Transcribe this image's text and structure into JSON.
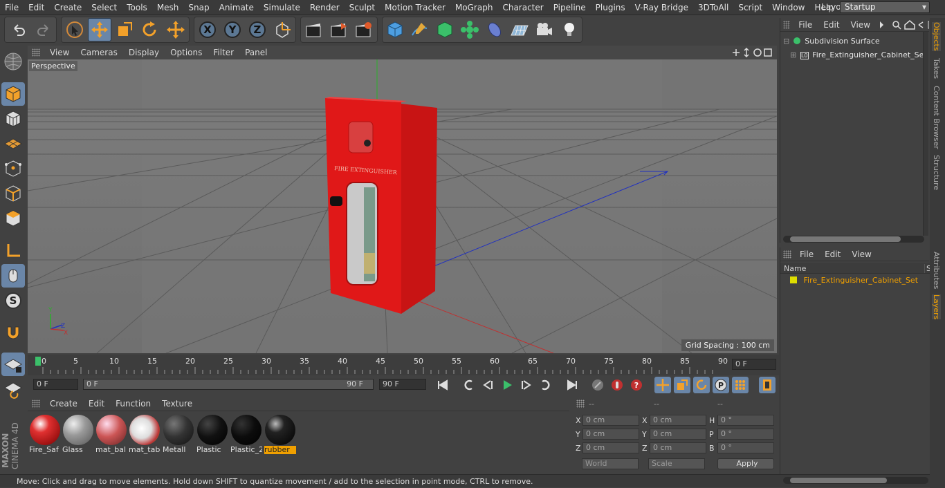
{
  "menu": [
    "File",
    "Edit",
    "Create",
    "Select",
    "Tools",
    "Mesh",
    "Snap",
    "Animate",
    "Simulate",
    "Render",
    "Sculpt",
    "Motion Tracker",
    "MoGraph",
    "Character",
    "Pipeline",
    "Plugins",
    "V-Ray Bridge",
    "3DToAll",
    "Script",
    "Window",
    "Help"
  ],
  "layout": {
    "label": "Layout:",
    "value": "Startup"
  },
  "viewport": {
    "menu": [
      "View",
      "Cameras",
      "Display",
      "Options",
      "Filter",
      "Panel"
    ],
    "camera_label": "Perspective",
    "grid_spacing": "Grid Spacing : 100 cm",
    "object_text": "FIRE EXTINGUISHER"
  },
  "timeline": {
    "ticks": [
      "0",
      "5",
      "10",
      "15",
      "20",
      "25",
      "30",
      "35",
      "40",
      "45",
      "50",
      "55",
      "60",
      "65",
      "70",
      "75",
      "80",
      "85",
      "90"
    ],
    "current_frame": "0 F"
  },
  "playbar": {
    "start": "0 F",
    "range_start": "0 F",
    "range_end": "90 F",
    "end": "90 F"
  },
  "materials": {
    "menu": [
      "Create",
      "Edit",
      "Function",
      "Texture"
    ],
    "items": [
      "Fire_Saf",
      "Glass",
      "mat_bal",
      "mat_tab",
      "Metall",
      "Plastic",
      "Plastic_2",
      "rubber"
    ],
    "selected": "rubber"
  },
  "coordinates": {
    "headers": [
      "--",
      "--",
      "--"
    ],
    "rows": [
      {
        "a": "X",
        "av": "0 cm",
        "b": "X",
        "bv": "0 cm",
        "c": "H",
        "cv": "0 °"
      },
      {
        "a": "Y",
        "av": "0 cm",
        "b": "Y",
        "bv": "0 cm",
        "c": "P",
        "cv": "0 °"
      },
      {
        "a": "Z",
        "av": "0 cm",
        "b": "Z",
        "bv": "0 cm",
        "c": "B",
        "cv": "0 °"
      }
    ],
    "mode1": "World",
    "mode2": "Scale",
    "apply": "Apply"
  },
  "objects": {
    "menu": [
      "File",
      "Edit",
      "View"
    ],
    "items": [
      "Subdivision Surface",
      "Fire_Extinguisher_Cabinet_Set"
    ]
  },
  "layers": {
    "menu": [
      "File",
      "Edit",
      "View"
    ],
    "column": "Name",
    "column2": "S",
    "items": [
      "Fire_Extinguisher_Cabinet_Set"
    ]
  },
  "side_tabs": [
    "Objects",
    "Takes",
    "Content Browser",
    "Structure",
    "Attributes",
    "Layers"
  ],
  "status": "Move: Click and drag to move elements. Hold down SHIFT to quantize movement / add to the selection in point mode, CTRL to remove.",
  "brand": [
    "MAXON",
    "CINEMA 4D"
  ]
}
